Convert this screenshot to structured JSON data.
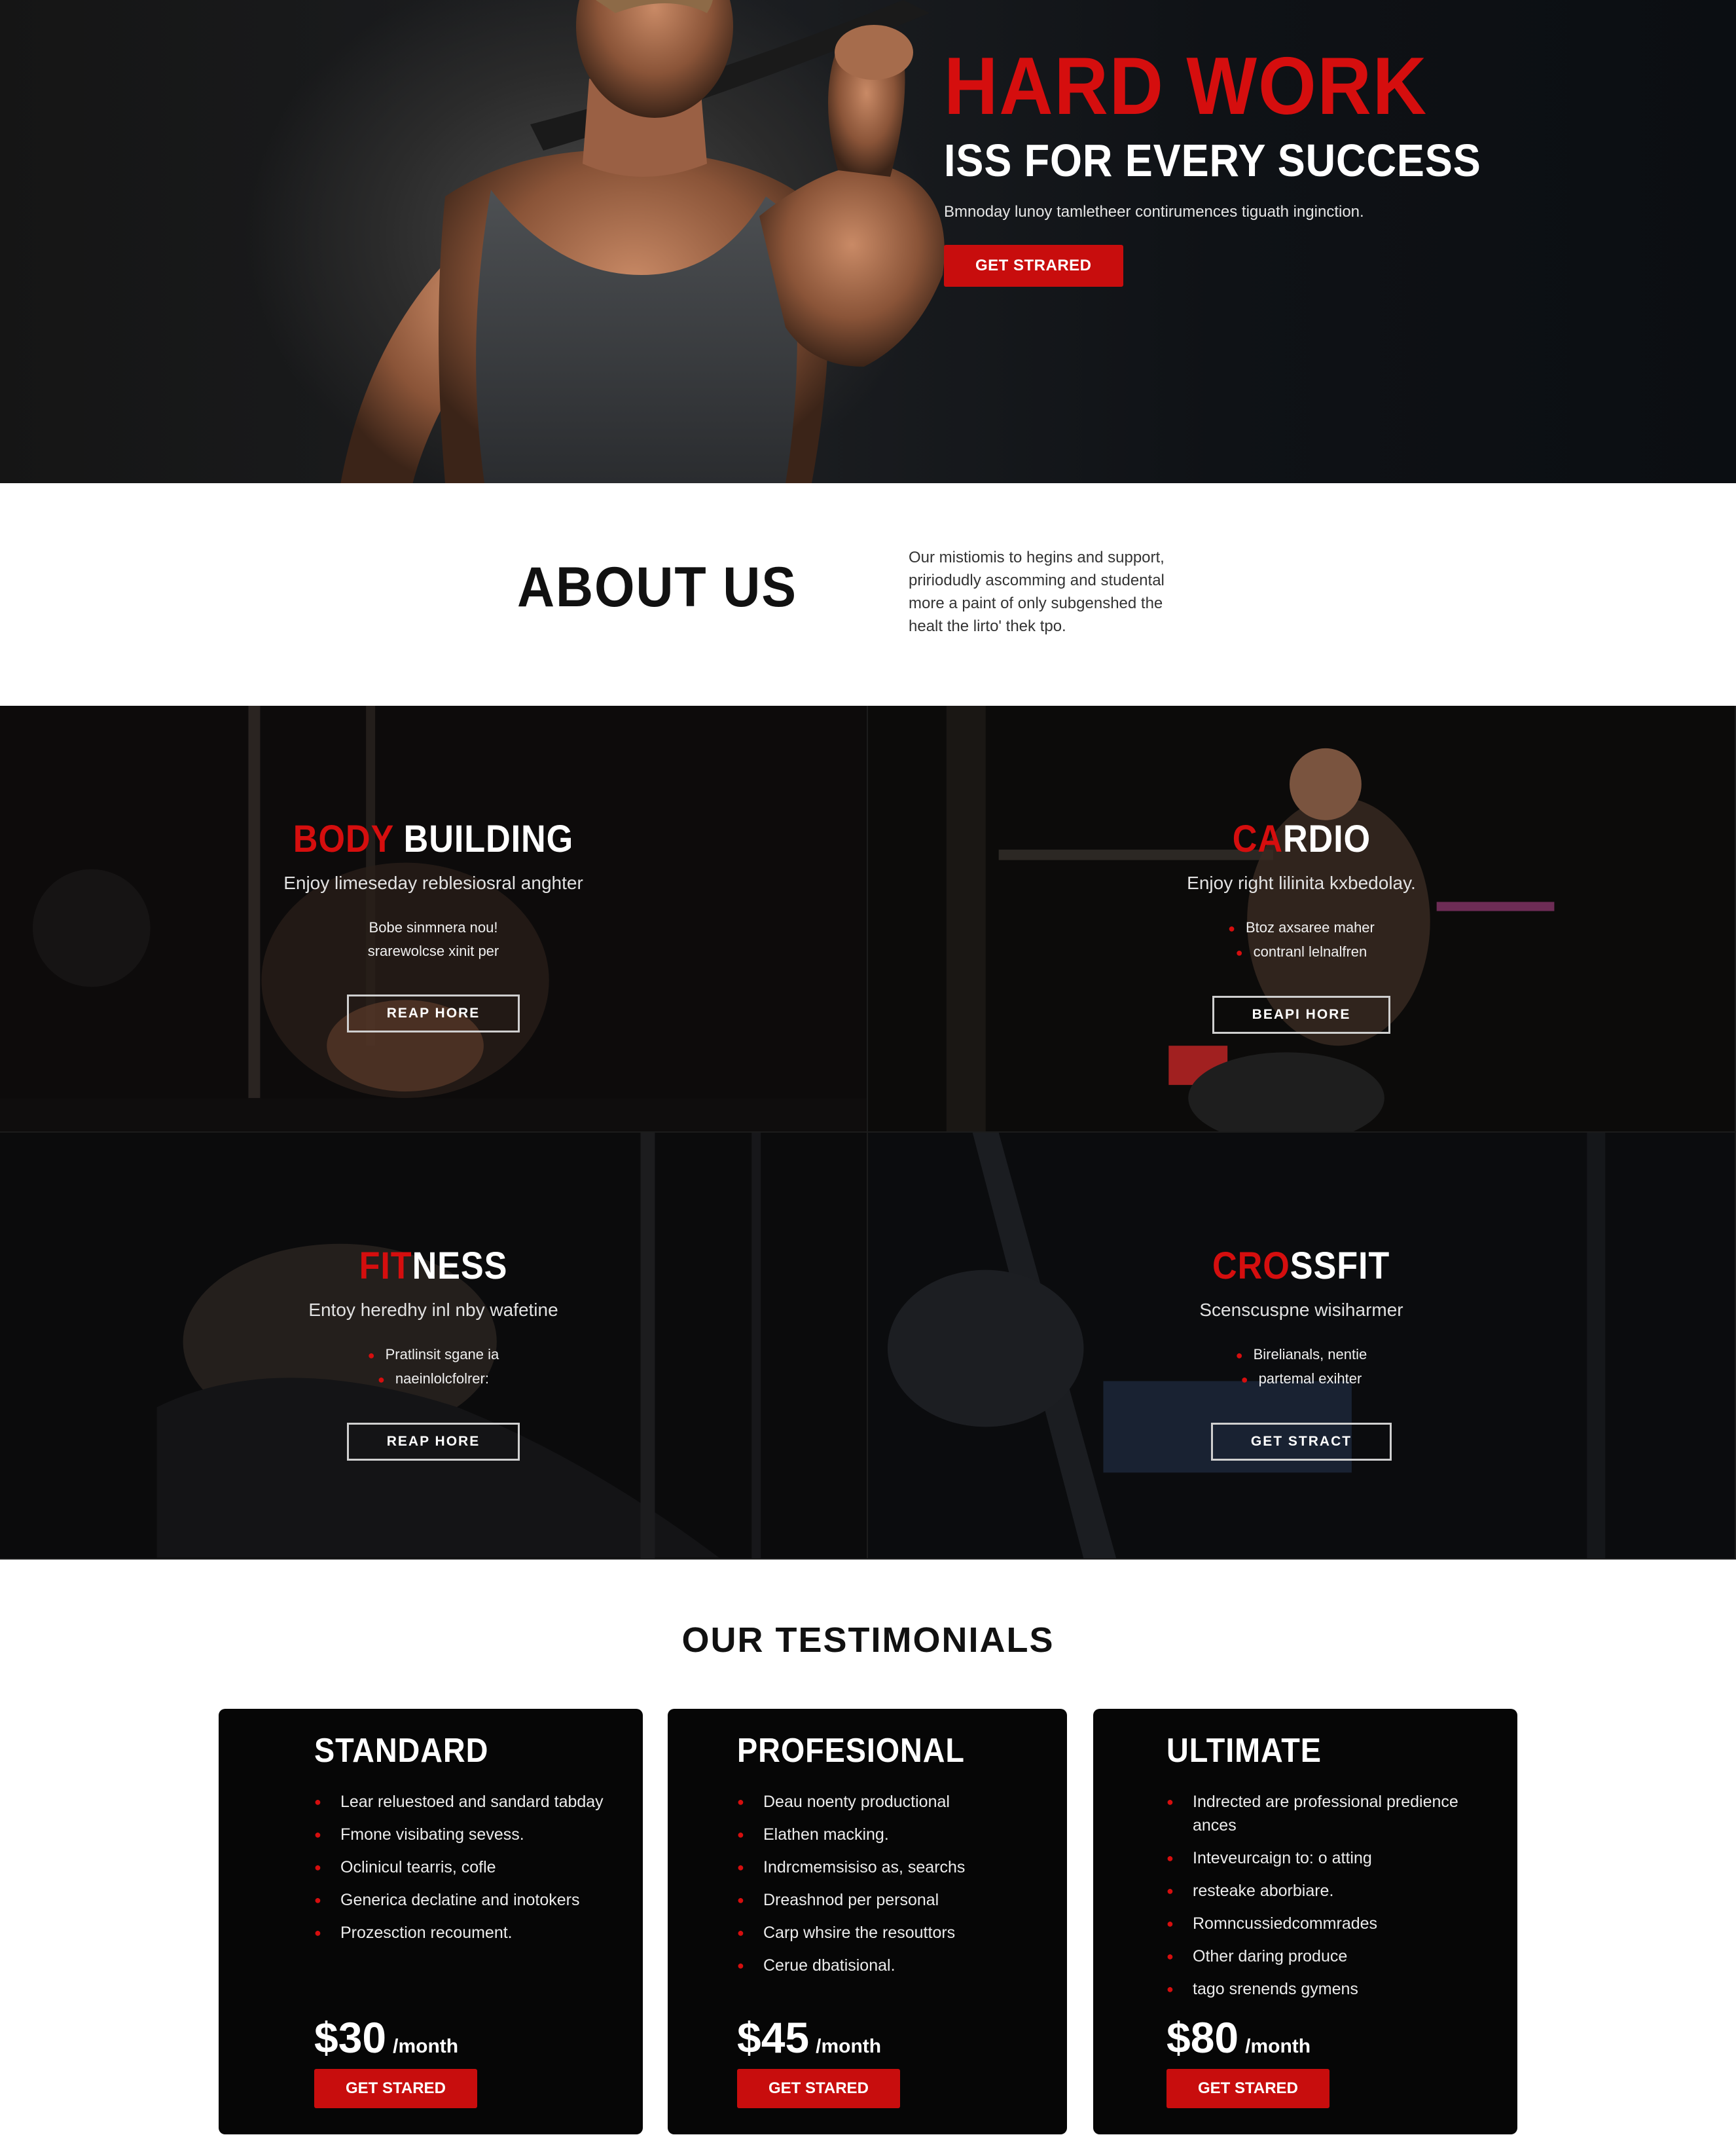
{
  "hero": {
    "title": "HARD WORK",
    "subtitle": "ISS FOR EVERY SUCCESS",
    "description": "Bmnoday lunoy tamletheer contirumences tiguath inginction.",
    "cta_label": "GET STRARED"
  },
  "about": {
    "title": "ABOUT US",
    "lines": [
      "Our mistiomis to hegins and support,",
      "pririodudly ascomming and studental",
      "more a paint of only subgenshed the",
      "healt the lirto' thek tpo."
    ]
  },
  "services": [
    {
      "title_red": "BODY",
      "title_white": " BUILDING",
      "subtitle": "Enjoy limeseday reblesiosral anghter",
      "bullets": [
        "Bobe sinmnera nou!",
        "srarewolcse xinit per"
      ],
      "show_dots": false,
      "button": "REAP HORE"
    },
    {
      "title_red": "CA",
      "title_white": "RDIO",
      "subtitle": "Enjoy right lilinita kxbedolay.",
      "bullets": [
        "Btoz axsaree maher",
        "contranl lelnalfren"
      ],
      "show_dots": true,
      "button": "BEAPI HORE"
    },
    {
      "title_red": "FIT",
      "title_white": "NESS",
      "subtitle": "Entoy heredhy inl nby wafetine",
      "bullets": [
        "Pratlinsit sgane ia",
        "naeinlolcfolrer:"
      ],
      "show_dots": true,
      "button": "REAP HORE"
    },
    {
      "title_red": "CRO",
      "title_white": "SSFIT",
      "subtitle": "Scenscuspne wisiharmer",
      "bullets": [
        "Birelianals, nentie",
        "partemal exihter"
      ],
      "show_dots": true,
      "button": "GET STRACT"
    }
  ],
  "testimonials": {
    "title": "OUR TESTIMONIALS",
    "plans": [
      {
        "name": "STANDARD",
        "features": [
          "Lear reluestoed and sandard tabday",
          "Fmone visibating sevess.",
          "Oclinicul tearris, cofle",
          "Generica declatine and inotokers",
          "Prozesction recoument."
        ],
        "price": "$30",
        "period": "/month",
        "cta": "GET STARED"
      },
      {
        "name": "PROFESIONAL",
        "features": [
          "Deau noenty productional",
          "Elathen macking.",
          "Indrcmemsisiso as, searchs",
          "Dreashnod per personal",
          "Carp whsire the resouttors",
          "Cerue dbatisional."
        ],
        "price": "$45",
        "period": "/month",
        "cta": "GET STARED"
      },
      {
        "name": "ULTIMATE",
        "features": [
          "Indrected are professional predience ances",
          "Inteveurcaign to: o atting",
          "resteake aborbiare.",
          "Romncussiedcommrades",
          "Other daring produce",
          "tago srenends gymens"
        ],
        "price": "$80",
        "period": "/month",
        "cta": "GET STARED"
      }
    ]
  },
  "colors": {
    "accent": "#d50e0e",
    "button": "#c80d0d",
    "dark": "#060606"
  }
}
